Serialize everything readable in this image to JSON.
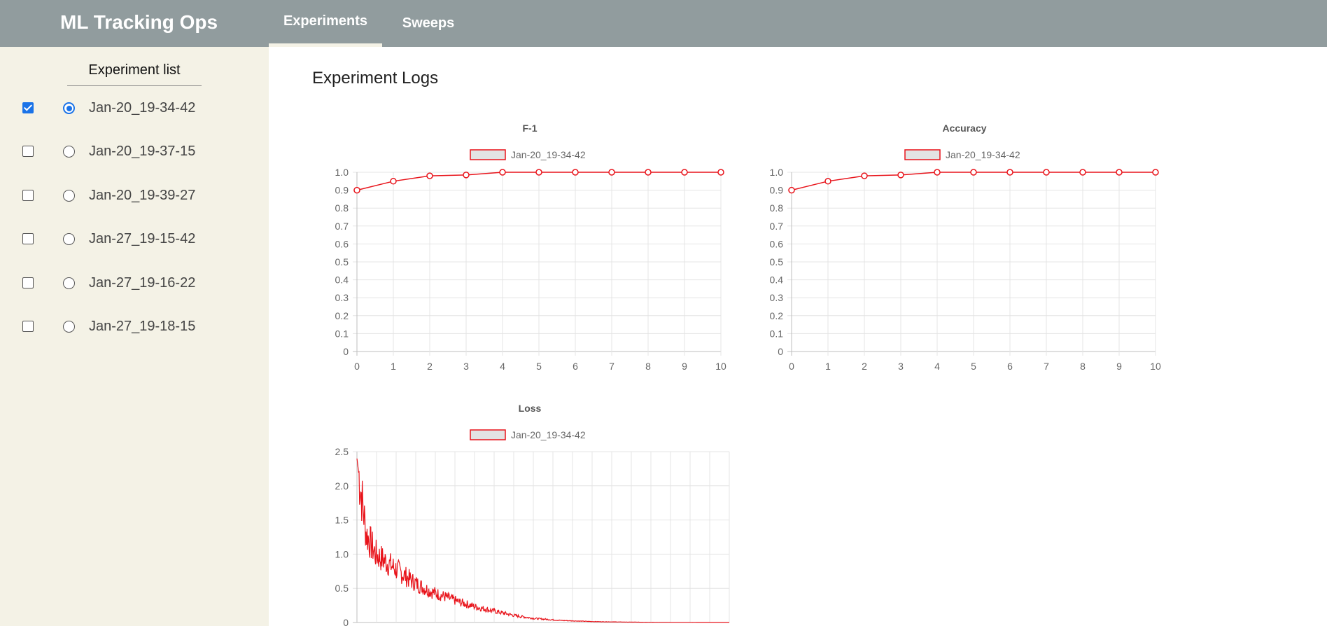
{
  "header": {
    "brand": "ML Tracking Ops",
    "tabs": [
      {
        "label": "Experiments",
        "active": true
      },
      {
        "label": "Sweeps",
        "active": false
      }
    ]
  },
  "sidebar": {
    "title": "Experiment list",
    "experiments": [
      {
        "name": "Jan-20_19-34-42",
        "checked": true,
        "selected": true
      },
      {
        "name": "Jan-20_19-37-15",
        "checked": false,
        "selected": false
      },
      {
        "name": "Jan-20_19-39-27",
        "checked": false,
        "selected": false
      },
      {
        "name": "Jan-27_19-15-42",
        "checked": false,
        "selected": false
      },
      {
        "name": "Jan-27_19-16-22",
        "checked": false,
        "selected": false
      },
      {
        "name": "Jan-27_19-18-15",
        "checked": false,
        "selected": false
      }
    ]
  },
  "main": {
    "title": "Experiment Logs"
  },
  "colors": {
    "series": "#e8141b",
    "header_bg": "#919c9e",
    "sidebar_bg": "#f4f2e6",
    "accent": "#1a73e8"
  },
  "chart_data": [
    {
      "type": "line",
      "title": "F-1",
      "legend": [
        "Jan-20_19-34-42"
      ],
      "legend_position": "top",
      "grid": true,
      "x": [
        0,
        1,
        2,
        3,
        4,
        5,
        6,
        7,
        8,
        9,
        10
      ],
      "xlim": [
        0,
        10
      ],
      "ylim": [
        0,
        1.0
      ],
      "yticks": [
        "0",
        "0.1",
        "0.2",
        "0.3",
        "0.4",
        "0.5",
        "0.6",
        "0.7",
        "0.8",
        "0.9",
        "1.0"
      ],
      "series": [
        {
          "name": "Jan-20_19-34-42",
          "values": [
            0.9,
            0.95,
            0.98,
            0.985,
            1.0,
            1.0,
            1.0,
            1.0,
            1.0,
            1.0,
            1.0
          ]
        }
      ]
    },
    {
      "type": "line",
      "title": "Accuracy",
      "legend": [
        "Jan-20_19-34-42"
      ],
      "legend_position": "top",
      "grid": true,
      "x": [
        0,
        1,
        2,
        3,
        4,
        5,
        6,
        7,
        8,
        9,
        10
      ],
      "xlim": [
        0,
        10
      ],
      "ylim": [
        0,
        1.0
      ],
      "yticks": [
        "0",
        "0.1",
        "0.2",
        "0.3",
        "0.4",
        "0.5",
        "0.6",
        "0.7",
        "0.8",
        "0.9",
        "1.0"
      ],
      "series": [
        {
          "name": "Jan-20_19-34-42",
          "values": [
            0.9,
            0.95,
            0.98,
            0.985,
            1.0,
            1.0,
            1.0,
            1.0,
            1.0,
            1.0,
            1.0
          ]
        }
      ]
    },
    {
      "type": "line",
      "title": "Loss",
      "legend": [
        "Jan-20_19-34-42"
      ],
      "legend_position": "top",
      "grid": true,
      "ylim": [
        0,
        2.5
      ],
      "yticks": [
        "0",
        "0.5",
        "1.0",
        "1.5",
        "2.0",
        "2.5"
      ],
      "series": [
        {
          "name": "Jan-20_19-34-42",
          "values": [
            2.4,
            1.3,
            1.0,
            0.9,
            0.8,
            0.7,
            0.6,
            0.52,
            0.45,
            0.4,
            0.35,
            0.3,
            0.26,
            0.22,
            0.19,
            0.16,
            0.13,
            0.1,
            0.08,
            0.06,
            0.05,
            0.04,
            0.03,
            0.025,
            0.02,
            0.015,
            0.012,
            0.01,
            0.008,
            0.006,
            0.005,
            0.004,
            0.003,
            0.003,
            0.002,
            0.002,
            0.002,
            0.001,
            0.001,
            0.001,
            0.001
          ]
        }
      ]
    }
  ]
}
